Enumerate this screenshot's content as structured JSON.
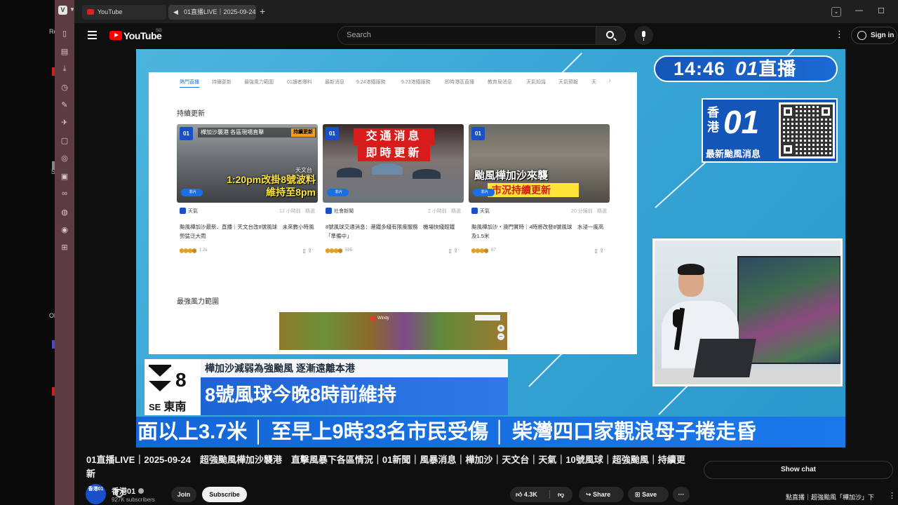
{
  "browser": {
    "tabs": [
      {
        "label": "YouTube"
      },
      {
        "label": "01直播LIVE｜2025-09-24"
      }
    ]
  },
  "desktop": {
    "fragments": [
      "Re",
      "S",
      "Ol"
    ]
  },
  "header": {
    "logo_text": "YouTube",
    "logo_region": "SG",
    "search_placeholder": "Search",
    "sign_in_label": "Sign in"
  },
  "video_screen": {
    "nav": [
      "熱門直播",
      "持續更新",
      "最強風力範圍",
      "01讀者爆料",
      "最新消息",
      "9.24港鐵服務",
      "9.23港鐵服務",
      "即時港區直播",
      "教育局消息",
      "天氣知識",
      "天氣預報",
      "天"
    ],
    "section_live": "持續更新",
    "cards": [
      {
        "thumb_top": "樺加沙襲港 各區現場直擊",
        "thumb_badge": "持續更新",
        "thumb_tag": "天文台",
        "thumb_big": "1:20pm改掛8號波料維持至8pm",
        "pill": "影片",
        "category": "天氣",
        "time": "12 小時前 · 精選",
        "title": "颱風樺加沙最新．直播｜天文台改8號風球　未來數小時風勢猛泛大雨",
        "count": "1.2k"
      },
      {
        "thumb_l1": "交通消息",
        "thumb_l2": "即時更新",
        "pill": "影片",
        "category": "社會新聞",
        "time": "2 小時前 · 精選",
        "title": "8號風球交通消息：港鐵多綫有限度服務　機場快綫輕鐵「準備中」",
        "count": "595"
      },
      {
        "thumb_l1": "颱風樺加沙來襲",
        "thumb_l2": "市況持續更新",
        "pill": "影片",
        "category": "天氣",
        "time": "20 分鐘前 · 精選",
        "title": "颱風樺加沙・澳門實時｜4時將改發8號風球　水浸一度高及1.5米",
        "count": "87"
      }
    ],
    "section_wind": "最強風力範圍",
    "windy_label": "Windy"
  },
  "overlay": {
    "clock": "14:46",
    "brand_short": "01",
    "live_word": "直播",
    "brand_hk": "香港",
    "brand_news": "最新颱風消息",
    "signal_number": "8",
    "signal_dir_en": "SE",
    "signal_dir_zh": "東南",
    "subheadline": "樺加沙減弱為強颱風 逐漸遠離本港",
    "headline": "8號風球今晚8時前維持",
    "ticker": "面以上3.7米 │ 至早上9時33名市民受傷 │ 柴灣四口家觀浪母子捲走昏"
  },
  "video": {
    "title": "01直播LIVE｜2025-09-24　超強颱風樺加沙襲港　直擊風暴下各區情況｜01新聞｜風暴消息｜樺加沙｜天文台｜天氣｜10號風球｜超強颱風｜持續更新",
    "show_chat": "Show chat",
    "channel": {
      "name": "香港01",
      "avatar_text": "香港01",
      "subscribers": "927K subscribers"
    },
    "join_label": "Join",
    "subscribe_label": "Subscribe",
    "like_count": "4.3K",
    "share_label": "Share",
    "save_label": "Save",
    "more_label": "···"
  },
  "recommendation": {
    "snippet": "點直播｜超強颱風「樺加沙」下"
  },
  "icons": [
    "vivaldi-logo-icon",
    "youtube-tab-icon",
    "speaker-icon",
    "new-tab-icon",
    "hamburger-menu-icon",
    "youtube-logo-icon",
    "search-icon",
    "mic-icon",
    "kebab-menu-icon",
    "account-icon",
    "like-icon",
    "dislike-icon",
    "share-icon",
    "save-icon",
    "verified-icon",
    "settings-gear-icon"
  ],
  "colors": {
    "youtube_red": "#ff0000",
    "brand_blue": "#1950c8",
    "ticker_blue": "#1a78ea",
    "sidebar": "#5c3c40",
    "subscribe_bg": "#f1f1f1"
  }
}
